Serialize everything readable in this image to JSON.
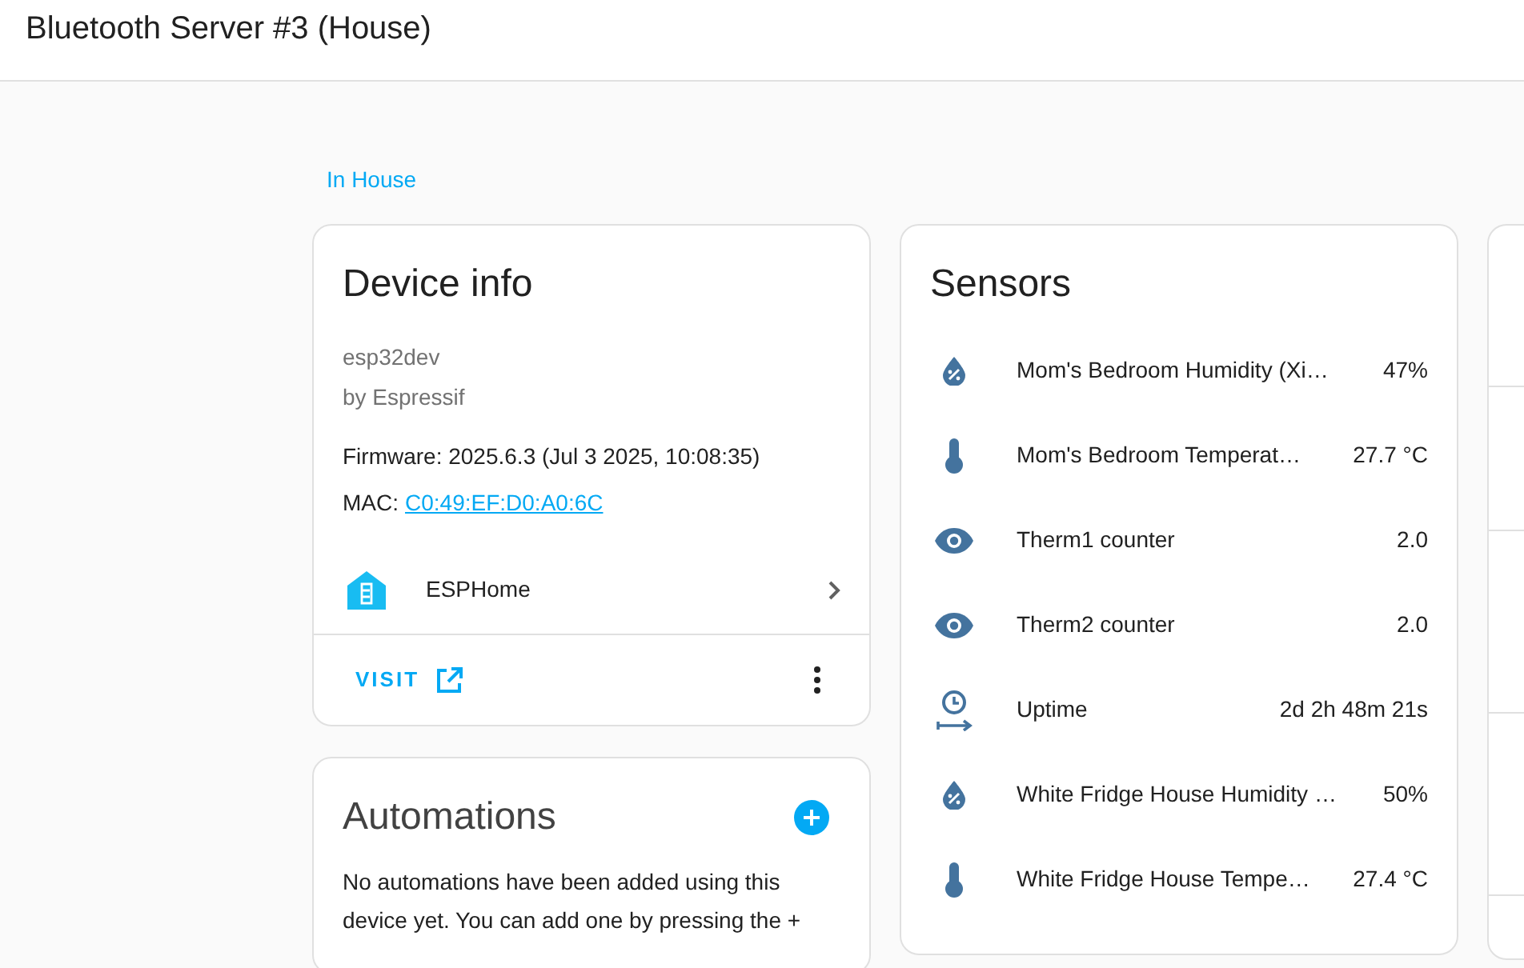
{
  "header": {
    "title": "Bluetooth Server #3 (House)"
  },
  "area_link": "In House",
  "device_info": {
    "title": "Device info",
    "model": "esp32dev",
    "manufacturer": "by Espressif",
    "firmware": "Firmware: 2025.6.3 (Jul 3 2025, 10:08:35)",
    "mac_label": "MAC:",
    "mac": "C0:49:EF:D0:A0:6C",
    "integration": "ESPHome",
    "visit": "VISIT"
  },
  "automations": {
    "title": "Automations",
    "text": "No automations have been added using this device yet. You can add one by pressing the +"
  },
  "sensors": {
    "title": "Sensors",
    "items": [
      {
        "kind": "humidity",
        "name": "Mom's Bedroom Humidity (Xi…",
        "value": "47%"
      },
      {
        "kind": "temperature",
        "name": "Mom's Bedroom Temperat…",
        "value": "27.7 °C"
      },
      {
        "kind": "eye",
        "name": "Therm1 counter",
        "value": "2.0"
      },
      {
        "kind": "eye",
        "name": "Therm2 counter",
        "value": "2.0"
      },
      {
        "kind": "timer",
        "name": "Uptime",
        "value": "2d 2h 48m 21s"
      },
      {
        "kind": "humidity",
        "name": "White Fridge House Humidity …",
        "value": "50%"
      },
      {
        "kind": "temperature",
        "name": "White Fridge House Tempe…",
        "value": "27.4 °C"
      }
    ]
  }
}
